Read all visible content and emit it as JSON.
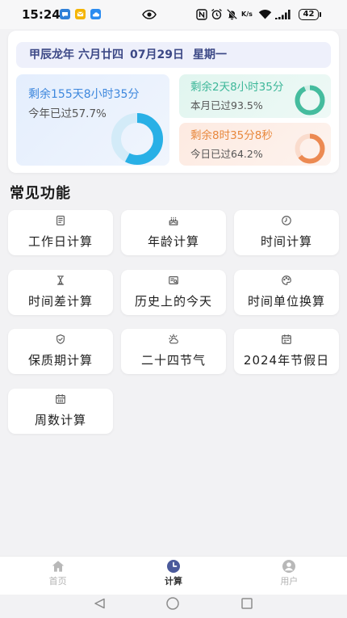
{
  "status_bar": {
    "time": "15:24",
    "notification_icons": [
      "message-icon",
      "mail-icon",
      "cloud-icon"
    ],
    "center_icon": "eye-icon",
    "system_icons": [
      "nfc-icon",
      "alarm-icon",
      "mute-icon",
      "wifi-icon",
      "signal-icon",
      "battery-icon"
    ],
    "network_speed_unit": "K/s",
    "battery_level": "42"
  },
  "date_banner": {
    "lunar_year": "甲辰龙年",
    "lunar_date": "六月廿四",
    "solar_date": "07月29日",
    "weekday": "星期一"
  },
  "progress": {
    "year": {
      "remaining": "剩余155天8小时35分",
      "passed": "今年已过57.7%",
      "percent": 57.7,
      "text_color": "#3d87dd",
      "ring_color": "#29b0e6",
      "track_color": "#d3ebf8"
    },
    "month": {
      "remaining": "剩余2天8小时35分",
      "passed": "本月已过93.5%",
      "percent": 93.5,
      "text_color": "#3db799",
      "ring_color": "#45bc9e",
      "track_color": "#d4efe7"
    },
    "day": {
      "remaining": "剩余8时35分8秒",
      "passed": "今日已过64.2%",
      "percent": 64.2,
      "text_color": "#e8883d",
      "ring_color": "#ec8a52",
      "track_color": "#fadccd"
    }
  },
  "functions": {
    "title": "常见功能",
    "items": [
      {
        "label": "工作日计算",
        "icon": "document-icon"
      },
      {
        "label": "年龄计算",
        "icon": "cake-icon"
      },
      {
        "label": "时间计算",
        "icon": "clock-icon"
      },
      {
        "label": "时间差计算",
        "icon": "hourglass-icon"
      },
      {
        "label": "历史上的今天",
        "icon": "calendar-search-icon"
      },
      {
        "label": "时间单位换算",
        "icon": "palette-icon"
      },
      {
        "label": "保质期计算",
        "icon": "shield-check-icon"
      },
      {
        "label": "二十四节气",
        "icon": "weather-icon"
      },
      {
        "label": "2024年节假日",
        "icon": "calendar-icon"
      },
      {
        "label": "周数计算",
        "icon": "calendar-week-icon"
      }
    ]
  },
  "bottom_nav": {
    "items": [
      {
        "label": "首页",
        "icon": "home-icon",
        "active": false
      },
      {
        "label": "计算",
        "icon": "clock-icon",
        "active": true
      },
      {
        "label": "用户",
        "icon": "user-icon",
        "active": false
      }
    ],
    "active_color": "#333333",
    "inactive_color": "#b3b3b3",
    "active_icon_color": "#4b5a9b"
  },
  "system_nav": {
    "icons": [
      "back-icon",
      "home-circle-icon",
      "recents-icon"
    ]
  }
}
